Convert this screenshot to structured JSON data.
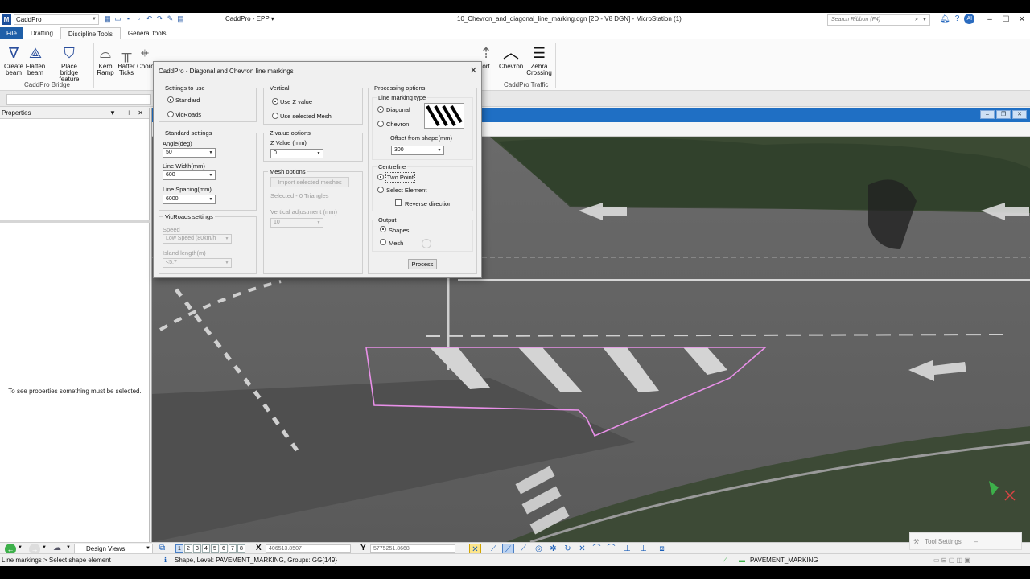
{
  "app": {
    "workspace_selector": "CaddPro",
    "workset": "CaddPro - EPP",
    "document_title": "10_Chevron_and_diagonal_line_marking.dgn [2D - V8 DGN] - MicroStation (1)",
    "search_placeholder": "Search Ribbon (F4)",
    "user_initials": "AI"
  },
  "tabs": [
    "File",
    "Drafting",
    "Discipline Tools",
    "General tools"
  ],
  "ribbon": {
    "bridge_group": {
      "label": "CaddPro Bridge",
      "buttons": [
        "Create beam",
        "Flatten beam",
        "Place bridge feature"
      ]
    },
    "kerb": [
      "Kerb Ramp",
      "Batter Ticks",
      "Coord"
    ],
    "hidden_fragment": "ort",
    "traffic_group": {
      "label": "CaddPro Traffic",
      "buttons": [
        "Chevron",
        "Zebra Crossing"
      ]
    }
  },
  "properties": {
    "title": "Properties",
    "empty_message": "To see properties something must be selected."
  },
  "dialog": {
    "title": "CaddPro - Diagonal and Chevron line markings",
    "settings_to_use": {
      "title": "Settings to use",
      "options": [
        "Standard",
        "VicRoads"
      ],
      "selected": "Standard"
    },
    "standard_settings": {
      "title": "Standard settings",
      "angle_label": "Angle(deg)",
      "angle_value": "50",
      "width_label": "Line Width(mm)",
      "width_value": "600",
      "spacing_label": "Line Spacing(mm)",
      "spacing_value": "6000"
    },
    "vicroads_settings": {
      "title": "VicRoads settings",
      "speed_label": "Speed",
      "speed_value": "Low Speed (80km/h",
      "island_label": "Island length(m)",
      "island_value": "<5.7"
    },
    "vertical": {
      "title": "Vertical",
      "options": [
        "Use Z value",
        "Use selected Mesh"
      ],
      "selected": "Use Z value"
    },
    "z_value_options": {
      "title": "Z value options",
      "label": "Z Value (mm)",
      "value": "0"
    },
    "mesh_options": {
      "title": "Mesh options",
      "import_button": "Import selected meshes",
      "selected_text": "Selected - 0 Triangles",
      "vadj_label": "Vertical adjustment (mm)",
      "vadj_value": "10"
    },
    "processing": {
      "title": "Processing options",
      "marking_type_title": "Line marking type",
      "types": [
        "Diagonal",
        "Chevron"
      ],
      "selected_type": "Diagonal",
      "offset_label": "Offset from shape(mm)",
      "offset_value": "300",
      "centreline_title": "Centreline",
      "centreline_options": [
        "Two Point",
        "Select Element"
      ],
      "centreline_selected": "Two Point",
      "reverse_label": "Reverse direction",
      "output_title": "Output",
      "output_options": [
        "Shapes",
        "Mesh"
      ],
      "output_selected": "Shapes",
      "process_button": "Process"
    }
  },
  "bottom": {
    "design_views": "Design Views",
    "view_numbers": [
      "1",
      "2",
      "3",
      "4",
      "5",
      "6",
      "7",
      "8"
    ],
    "active_view": "1",
    "x_label": "X",
    "x_value": "406513.8507",
    "y_label": "Y",
    "y_value": "5775251.8668",
    "tool_settings": "Tool Settings"
  },
  "status": {
    "prompt": "Line markings > Select shape element",
    "element_info": "Shape, Level: PAVEMENT_MARKING, Groups: GG{149}",
    "active_level": "PAVEMENT_MARKING"
  },
  "colors": {
    "accent": "#1f5fa8",
    "shape_outline": "#e890e8",
    "view_header": "#1f6fc4"
  }
}
